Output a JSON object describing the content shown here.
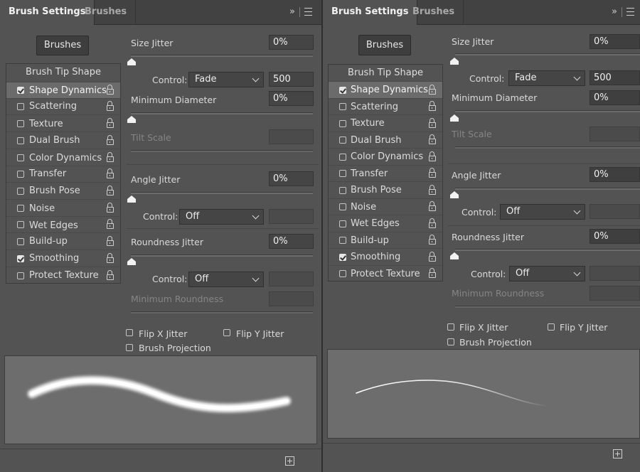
{
  "tabs": {
    "brush_settings": "Brush Settings",
    "brushes": "Brushes"
  },
  "tab_tools": {
    "collapse": "»"
  },
  "brushes_button": "Brushes",
  "brush_tip_shape": "Brush Tip Shape",
  "options": [
    {
      "label": "Shape Dynamics",
      "checked": true
    },
    {
      "label": "Scattering",
      "checked": false
    },
    {
      "label": "Texture",
      "checked": false
    },
    {
      "label": "Dual Brush",
      "checked": false
    },
    {
      "label": "Color Dynamics",
      "checked": false
    },
    {
      "label": "Transfer",
      "checked": false
    },
    {
      "label": "Brush Pose",
      "checked": false
    },
    {
      "label": "Noise",
      "checked": false
    },
    {
      "label": "Wet Edges",
      "checked": false
    },
    {
      "label": "Build-up",
      "checked": false
    },
    {
      "label": "Smoothing",
      "checked": true
    },
    {
      "label": "Protect Texture",
      "checked": false
    }
  ],
  "settings": {
    "size_jitter": "Size Jitter",
    "size_jitter_value": "0%",
    "control": "Control:",
    "size_control": "Fade",
    "size_fade_steps": "500",
    "minimum_diameter": "Minimum Diameter",
    "minimum_diameter_value": "0%",
    "tilt_scale": "Tilt Scale",
    "angle_jitter": "Angle Jitter",
    "angle_jitter_value": "0%",
    "angle_control": "Off",
    "roundness_jitter": "Roundness Jitter",
    "roundness_jitter_value": "0%",
    "roundness_control": "Off",
    "minimum_roundness": "Minimum Roundness",
    "flip_x": "Flip X Jitter",
    "flip_y": "Flip Y Jitter",
    "brush_projection": "Brush Projection"
  },
  "colors": {
    "panel_bg": "#535353",
    "tabbar_bg": "#424242",
    "preview_bg": "#6d6d6d",
    "checkbox_checked": "#e6e6e6"
  },
  "icons": [
    "collapse-icon",
    "panel-menu-icon",
    "lock-icon",
    "create-new-brush-icon"
  ]
}
